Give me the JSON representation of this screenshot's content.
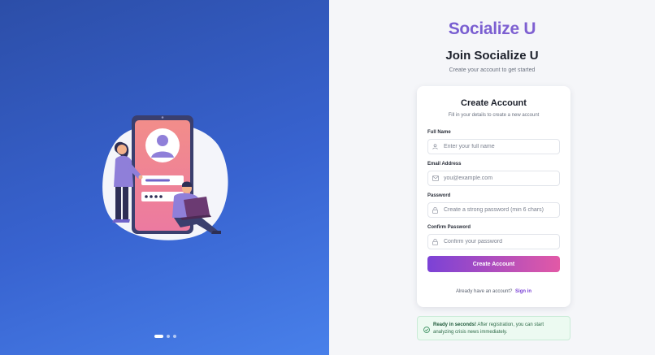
{
  "hero": {
    "carousel": {
      "slides": 3,
      "active": 1
    }
  },
  "brand": {
    "name": "Socialize U"
  },
  "header": {
    "title": "Join Socialize U",
    "subtitle": "Create your account to get started"
  },
  "card": {
    "title": "Create Account",
    "subtitle": "Fill in your details to create a new account",
    "fields": {
      "full_name": {
        "label": "Full Name",
        "placeholder": "Enter your full name",
        "icon": "user-icon"
      },
      "email": {
        "label": "Email Address",
        "placeholder": "you@example.com",
        "icon": "mail-icon"
      },
      "password": {
        "label": "Password",
        "placeholder": "Create a strong password (min 6 chars)",
        "icon": "lock-icon"
      },
      "confirm_password": {
        "label": "Confirm Password",
        "placeholder": "Confirm your password",
        "icon": "lock-icon"
      }
    },
    "submit_label": "Create Account",
    "signin_prompt": "Already have an account?",
    "signin_link": "Sign in"
  },
  "notice": {
    "strong": "Ready in seconds!",
    "text": "After registration, you can start analyzing crisis news immediately.",
    "icon": "check-circle-icon"
  },
  "colors": {
    "hero_start": "#2c4ea8",
    "hero_end": "#4880ea",
    "accent_purple": "#7b42d6",
    "accent_pink": "#e259a6",
    "success_bg": "#ecfaf1"
  }
}
